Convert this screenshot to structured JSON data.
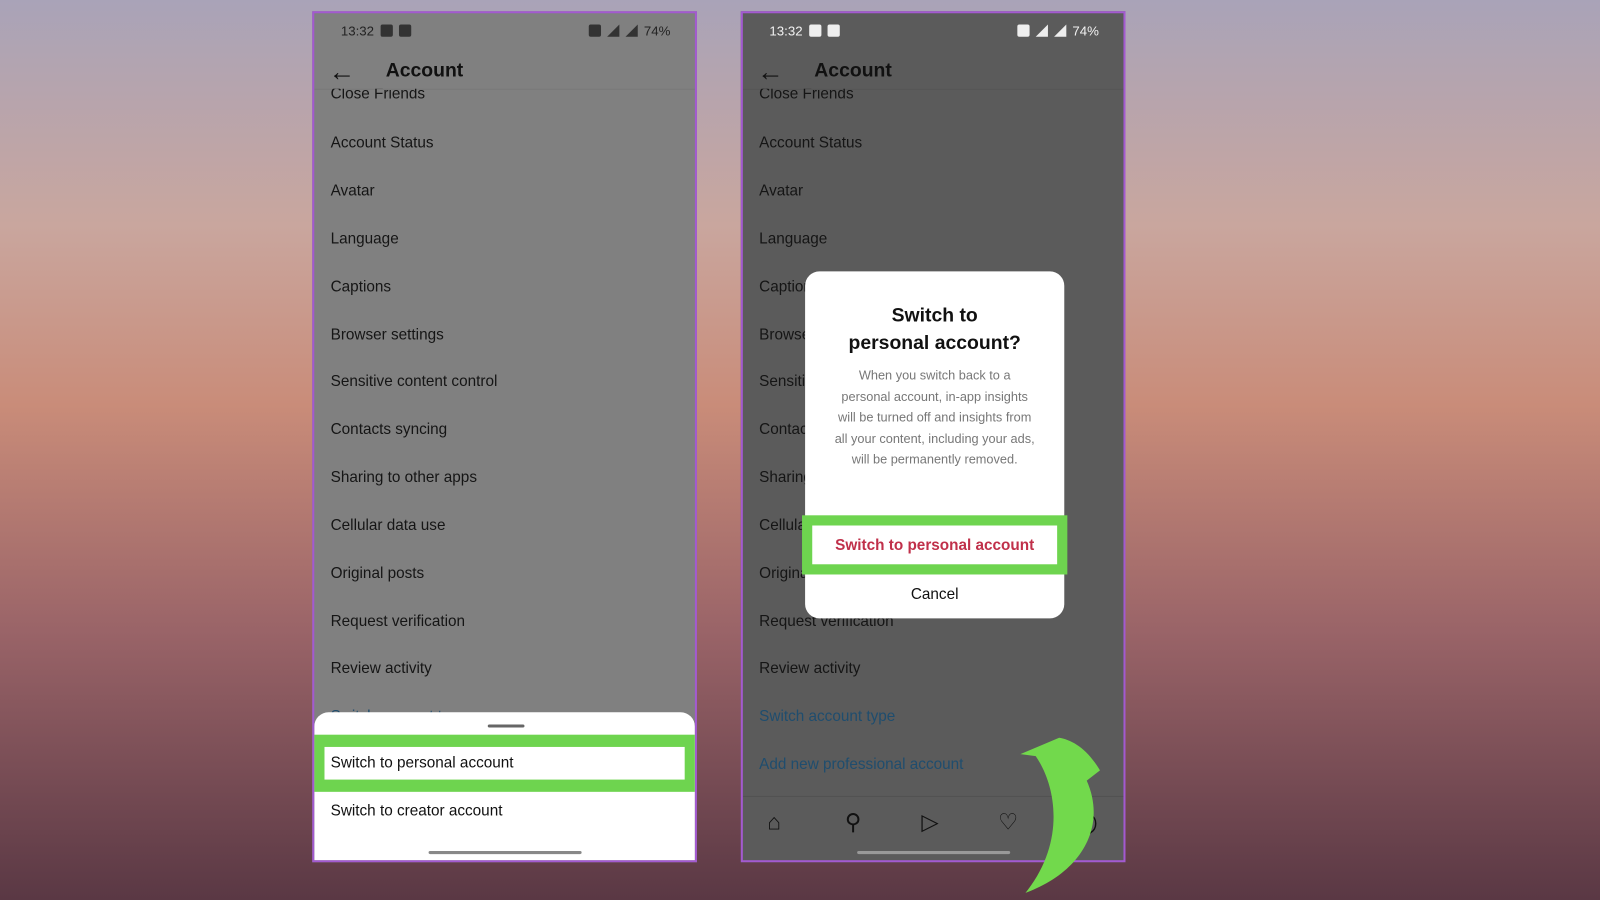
{
  "status": {
    "time": "13:32",
    "battery": "74%"
  },
  "header": {
    "title": "Account",
    "back_icon": "arrow-left-icon"
  },
  "list": {
    "partial_top": "Close Friends",
    "items": [
      "Account Status",
      "Avatar",
      "Language",
      "Captions",
      "Browser settings",
      "Sensitive content control",
      "Contacts syncing",
      "Sharing to other apps",
      "Cellular data use",
      "Original posts",
      "Request verification",
      "Review activity"
    ],
    "links": [
      "Switch account type",
      "Add new professional account"
    ]
  },
  "sheet": {
    "option1": "Switch to personal account",
    "option2": "Switch to creator account"
  },
  "dialog": {
    "title_line1": "Switch to",
    "title_line2": "personal account?",
    "body": "When you switch back to a personal account, in-app insights will be turned off and insights from all your content, including your ads, will be permanently removed.",
    "confirm": "Switch to personal account",
    "cancel": "Cancel"
  },
  "colors": {
    "highlight": "#6ed44f",
    "confirm": "#c0304a",
    "link": "#1f4d6e",
    "frame": "#a35ad0"
  }
}
